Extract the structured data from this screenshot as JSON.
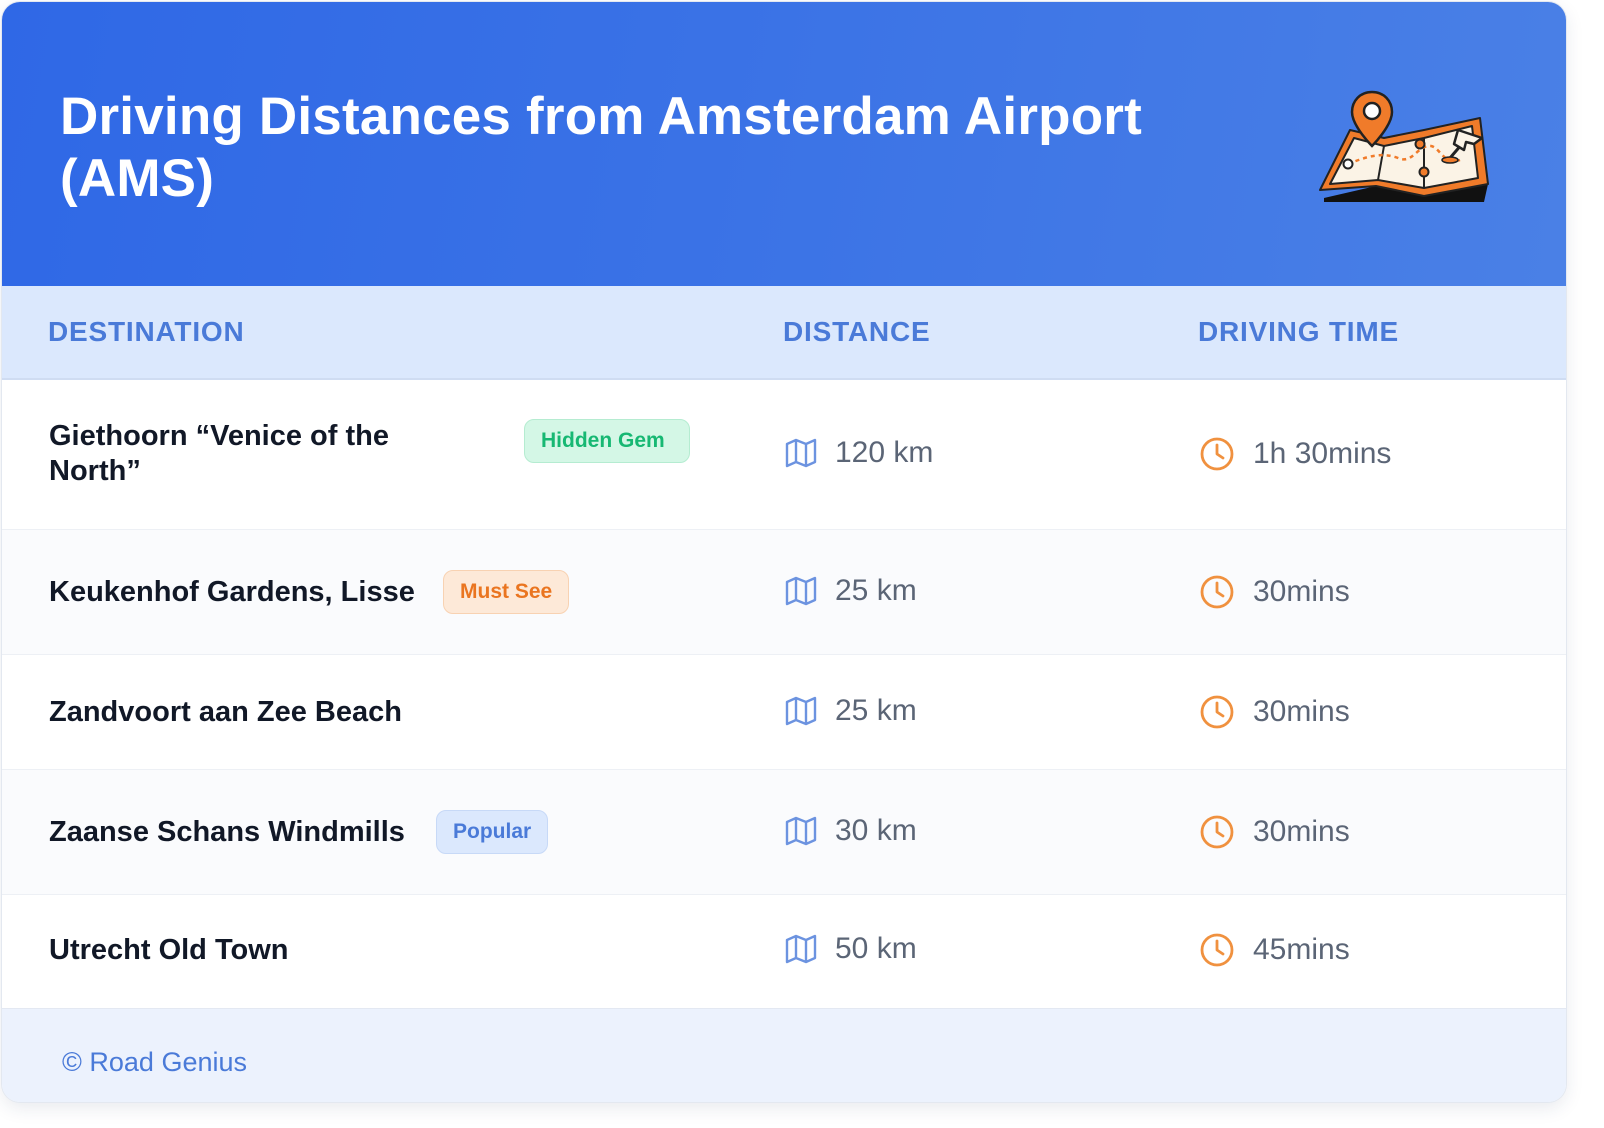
{
  "header": {
    "title": "Driving Distances from Amsterdam Airport (AMS)",
    "illustration_icon": "map-with-location-pin-icon"
  },
  "columns": {
    "destination": "DESTINATION",
    "distance": "DISTANCE",
    "driving_time": "DRIVING TIME"
  },
  "rows": [
    {
      "destination": "Giethoorn “Venice of the North”",
      "badge": "Hidden Gem",
      "badge_color": "#17b873",
      "distance": "120 km",
      "time": "1h 30mins"
    },
    {
      "destination": "Keukenhof Gardens, Lisse",
      "badge": "Must See",
      "badge_color": "#ea7520",
      "distance": "25 km",
      "time": "30mins"
    },
    {
      "destination": "Zandvoort aan Zee Beach",
      "badge": null,
      "distance": "25 km",
      "time": "30mins"
    },
    {
      "destination": "Zaanse Schans Windmills",
      "badge": "Popular",
      "badge_color": "#4a7ad8",
      "distance": "30 km",
      "time": "30mins"
    },
    {
      "destination": "Utrecht Old Town",
      "badge": null,
      "distance": "50 km",
      "time": "45mins"
    }
  ],
  "icons": {
    "distance": "map-icon",
    "time": "clock-icon"
  },
  "colors": {
    "header_gradient_start": "#2f68e6",
    "header_gradient_end": "#4a80e6",
    "accent_blue": "#4a7ad8",
    "accent_orange": "#ea7520"
  },
  "footer": {
    "text": "© Road Genius"
  }
}
